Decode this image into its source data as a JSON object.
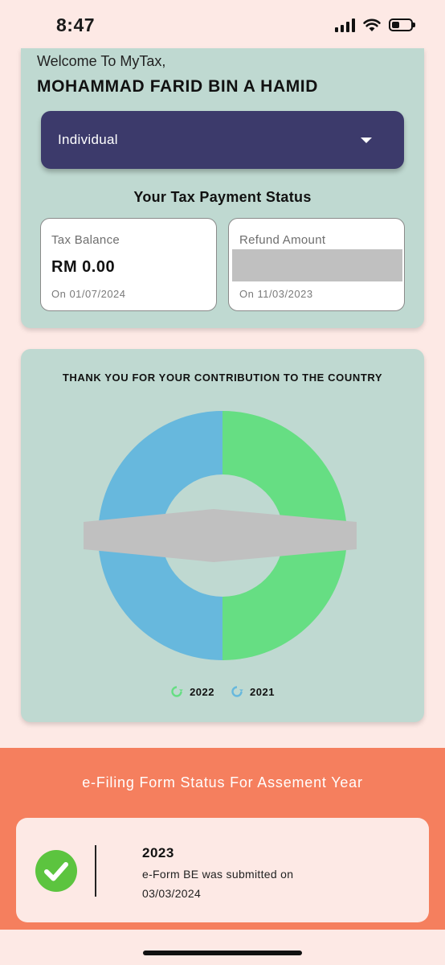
{
  "status_bar": {
    "time": "8:47",
    "signal_icon": "cellular-signal-icon",
    "wifi_icon": "wifi-icon",
    "battery_icon": "battery-icon"
  },
  "header": {
    "welcome": "Welcome To MyTax,",
    "user_name": "MOHAMMAD FARID BIN A HAMID"
  },
  "taxpayer_type": {
    "selected": "Individual",
    "icon": "chevron-down-icon"
  },
  "payment_status": {
    "title": "Your Tax Payment Status",
    "tax_balance": {
      "label": "Tax Balance",
      "value": "RM 0.00",
      "date": "On  01/07/2024"
    },
    "refund": {
      "label": "Refund Amount",
      "value": "",
      "date": "On  11/03/2023"
    }
  },
  "contribution": {
    "title": "THANK YOU FOR YOUR CONTRIBUTION TO THE COUNTRY",
    "colors": {
      "2022": "#66de83",
      "2021": "#67b8dd"
    }
  },
  "chart_data": {
    "type": "pie",
    "title": "THANK YOU FOR YOUR CONTRIBUTION TO THE COUNTRY",
    "categories": [
      "2022",
      "2021"
    ],
    "values": [
      50,
      50
    ],
    "colors": [
      "#66de83",
      "#67b8dd"
    ],
    "legend": "bottom"
  },
  "efiling": {
    "title": "e-Filing Form Status For Assement Year",
    "year": "2023",
    "line1": "e-Form BE was submitted on",
    "line2": "03/03/2024",
    "status_icon": "check-circle-icon"
  }
}
